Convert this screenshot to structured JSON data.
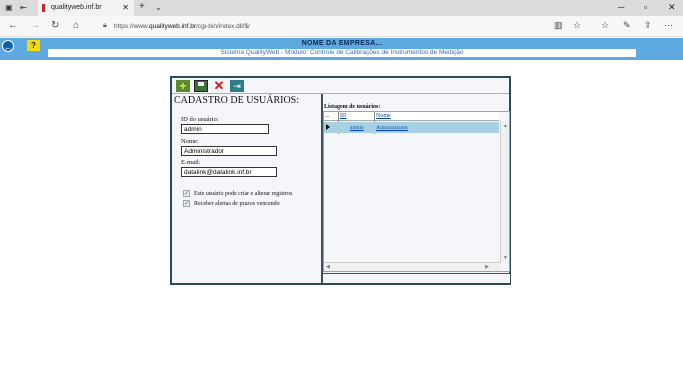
{
  "browser": {
    "tab_title": "qualityweb.inf.br",
    "url_prefix": "https://www.",
    "url_host": "qualityweb.inf.br",
    "url_path": "/cgi-bin/index.dll/$/"
  },
  "header": {
    "company": "NOME DA EMPRESA...",
    "subtitle": "Sistema QualityWeb - Módulo: Controle de Calibrações de Instrumentos de Medição",
    "help_label": "?"
  },
  "form": {
    "title": "CADASTRO DE USUÁRIOS:",
    "id_label": "ID do usuário:",
    "id_value": "admin",
    "name_label": "Nome:",
    "name_value": "Administrador",
    "email_label": "E-mail:",
    "email_value": "datalink@datalink.inf.br",
    "check1_label": "Este usuário pode criar e alterar registros",
    "check2_label": "Receber alertas de prazos vencendo"
  },
  "list": {
    "title": "Listagem de usuários:",
    "col_sel": "...",
    "col_id": "ID",
    "col_name": "Nome",
    "rows": [
      {
        "id": "admin",
        "name": "Administrador"
      }
    ]
  },
  "colors": {
    "header_bg": "#5ea9df",
    "selected_row": "#a7d1e3"
  }
}
